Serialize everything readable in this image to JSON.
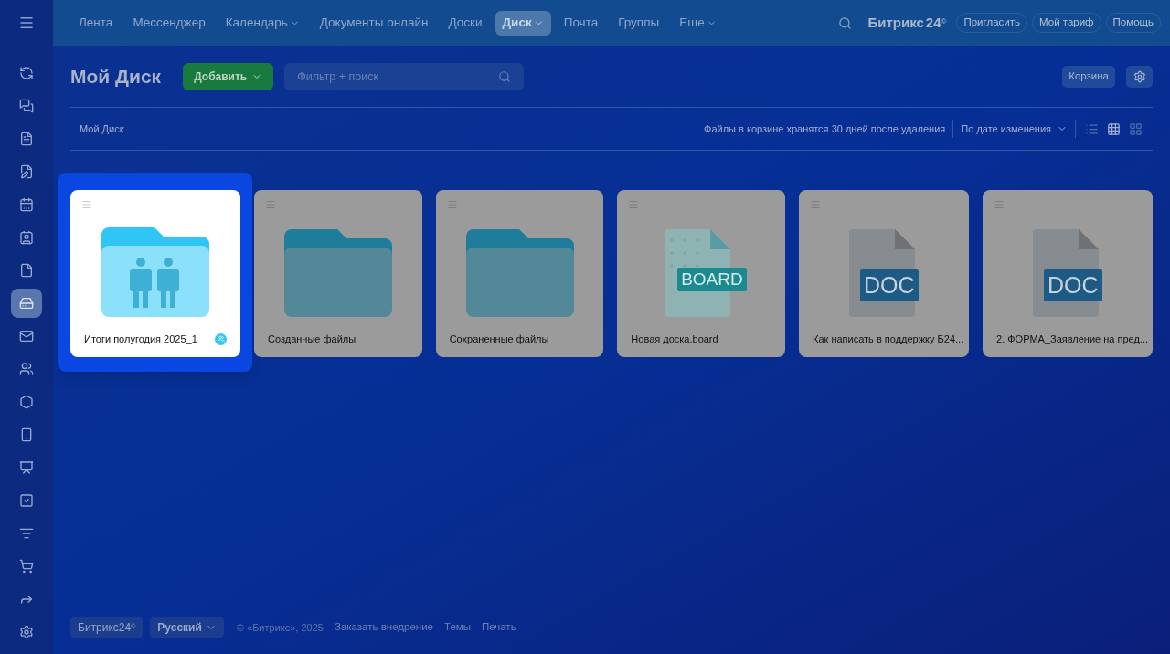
{
  "nav": [
    {
      "label": "Лента",
      "dropdown": false,
      "selected": false
    },
    {
      "label": "Мессенджер",
      "dropdown": false,
      "selected": false
    },
    {
      "label": "Календарь",
      "dropdown": true,
      "selected": false
    },
    {
      "label": "Документы онлайн",
      "dropdown": false,
      "selected": false
    },
    {
      "label": "Доски",
      "dropdown": false,
      "selected": false
    },
    {
      "label": "Диск",
      "dropdown": true,
      "selected": true
    },
    {
      "label": "Почта",
      "dropdown": false,
      "selected": false
    },
    {
      "label": "Группы",
      "dropdown": false,
      "selected": false
    },
    {
      "label": "Еще",
      "dropdown": true,
      "selected": false
    }
  ],
  "brand": {
    "name": "Битрикс",
    "number": "24",
    "mark": "©"
  },
  "header_buttons": [
    "Пригласить",
    "Мой тариф",
    "Помощь"
  ],
  "sidebar": [
    {
      "selected": false
    },
    {
      "selected": false
    },
    {
      "selected": false
    },
    {
      "selected": false
    },
    {
      "selected": false
    },
    {
      "selected": false
    },
    {
      "selected": false
    },
    {
      "selected": true
    },
    {
      "selected": false
    },
    {
      "selected": false
    },
    {
      "selected": false
    },
    {
      "selected": false
    },
    {
      "selected": false
    },
    {
      "selected": false
    },
    {
      "selected": false
    },
    {
      "selected": false
    },
    {
      "selected": false
    },
    {
      "selected": false
    }
  ],
  "page": {
    "title": "Мой Диск",
    "add_button": "Добавить",
    "search": {
      "placeholder": "Фильтр + поиск"
    },
    "trash_button": "Корзина"
  },
  "toolbar": {
    "breadcrumb": "Мой Диск",
    "notice": "Файлы в корзине хранятся 30 дней после удаления",
    "sort": "По дате изменения",
    "views": [
      {
        "selected": false
      },
      {
        "selected": true
      },
      {
        "selected": false
      }
    ]
  },
  "items": [
    {
      "kind": "shared-folder",
      "name": "Итоги полугодия 2025_1",
      "shared": true,
      "selected": true
    },
    {
      "kind": "folder",
      "name": "Созданные файлы",
      "shared": false,
      "selected": false
    },
    {
      "kind": "folder",
      "name": "Сохраненные файлы",
      "shared": false,
      "selected": false
    },
    {
      "kind": "board",
      "name": "Новая доска.board",
      "badge": "BOARD",
      "shared": false,
      "selected": false
    },
    {
      "kind": "doc",
      "name": "Как написать в поддержку Б24...",
      "badge": "DOC",
      "shared": false,
      "selected": false
    },
    {
      "kind": "doc",
      "name": "2. ФОРМА_Заявление на пред...",
      "badge": "DOC",
      "shared": false,
      "selected": false
    }
  ],
  "footer": {
    "brand": "Битрикс24",
    "brand_mark": "©",
    "language": "Русский",
    "copyright": "© «Битрикс», 2025",
    "links": [
      "Заказать внедрение",
      "Темы",
      "Печать"
    ]
  }
}
